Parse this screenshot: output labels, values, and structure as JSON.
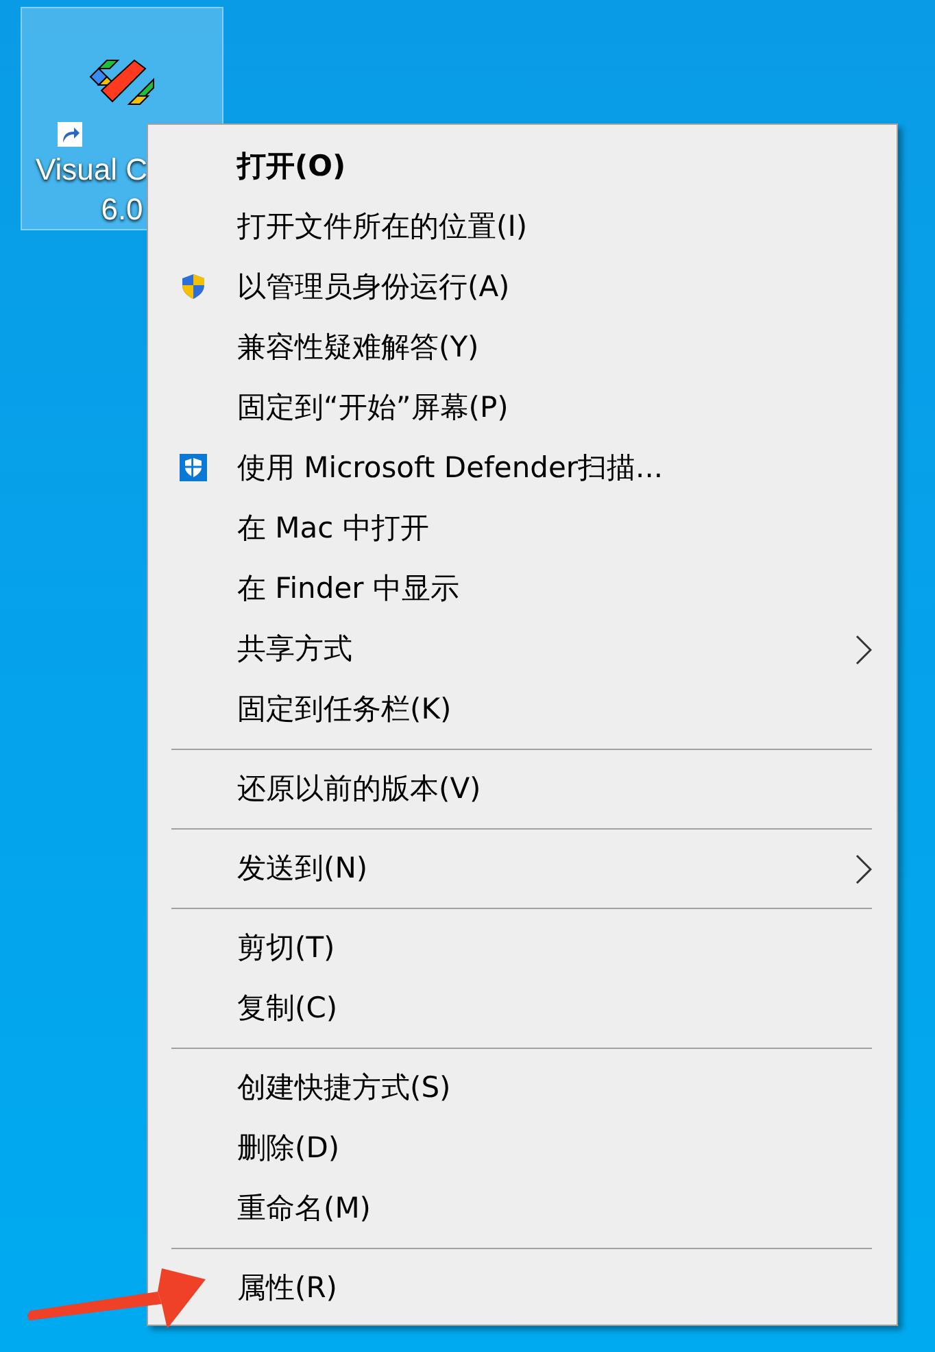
{
  "desktop": {
    "icon": {
      "label": [
        "Visual C",
        "6.0"
      ],
      "selected": true
    }
  },
  "context_menu": {
    "items": [
      {
        "kind": "item",
        "label": "打开(O)",
        "default": true
      },
      {
        "kind": "item",
        "label": "打开文件所在的位置(I)"
      },
      {
        "kind": "elevated",
        "label": "以管理员身份运行(A)"
      },
      {
        "kind": "item",
        "label": "兼容性疑难解答(Y)"
      },
      {
        "kind": "item",
        "label": "固定到“开始”屏幕(P)"
      },
      {
        "kind": "scan",
        "label": "使用 Microsoft Defender扫描..."
      },
      {
        "kind": "item",
        "label": "在 Mac 中打开"
      },
      {
        "kind": "item",
        "label": "在 Finder 中显示"
      },
      {
        "kind": "item",
        "label": "共享方式",
        "submenu": true
      },
      {
        "kind": "item",
        "label": "固定到任务栏(K)"
      },
      {
        "kind": "separator"
      },
      {
        "kind": "item",
        "label": "还原以前的版本(V)"
      },
      {
        "kind": "separator"
      },
      {
        "kind": "item",
        "label": "发送到(N)",
        "submenu": true
      },
      {
        "kind": "separator"
      },
      {
        "kind": "item",
        "label": "剪切(T)"
      },
      {
        "kind": "item",
        "label": "复制(C)"
      },
      {
        "kind": "separator"
      },
      {
        "kind": "item",
        "label": "创建快捷方式(S)"
      },
      {
        "kind": "item",
        "label": "删除(D)"
      },
      {
        "kind": "item",
        "label": "重命名(M)"
      },
      {
        "kind": "separator"
      },
      {
        "kind": "item",
        "label": "属性(R)"
      }
    ]
  }
}
